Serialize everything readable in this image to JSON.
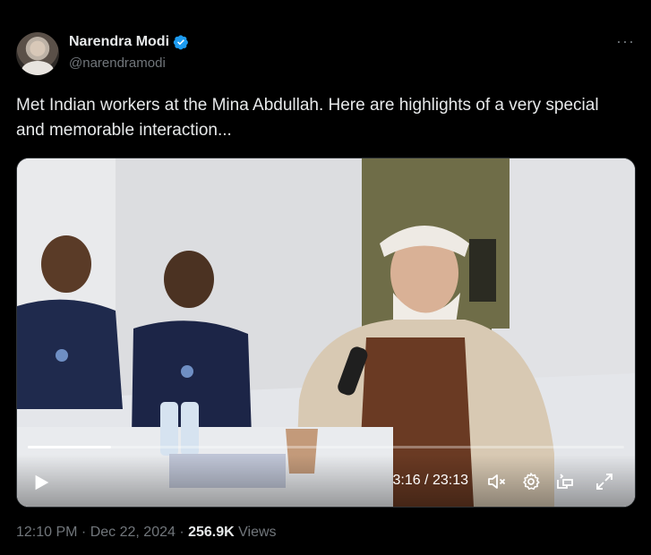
{
  "author": {
    "name": "Narendra Modi",
    "handle": "@narendramodi",
    "verified": true
  },
  "post": {
    "text": "Met Indian workers at the Mina Abdullah. Here are highlights of a very special and memorable interaction..."
  },
  "video": {
    "current_time": "3:16",
    "separator": " / ",
    "duration": "23:13",
    "progress_fraction": 0.14,
    "controls": [
      "play-icon",
      "mute-icon",
      "settings-icon",
      "pip-icon",
      "fullscreen-icon"
    ]
  },
  "meta": {
    "time": "12:10 PM",
    "dot1": " · ",
    "date": "Dec 22, 2024",
    "dot2": " · ",
    "views_count": "256.9K",
    "views_label": " Views"
  },
  "colors": {
    "background": "#000000",
    "text": "#e7e9ea",
    "muted": "#71767b",
    "verified_blue": "#1d9bf0"
  }
}
